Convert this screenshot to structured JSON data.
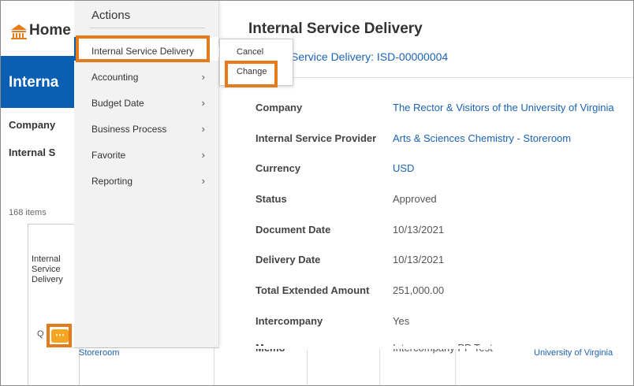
{
  "home": {
    "label": "Home"
  },
  "banner": {
    "label": "Interna"
  },
  "background": {
    "company_label": "Company",
    "isp_label": "Internal S",
    "items_count": "168 items",
    "grid_header": [
      "Internal",
      "Service",
      "Delivery"
    ],
    "search_glyph": "Q",
    "ellipsis": "⋯",
    "bottom_left": "Storeroom",
    "bottom_right": "University of Virginia"
  },
  "actions": {
    "title": "Actions",
    "items": [
      {
        "label": "Internal Service Delivery",
        "has_chevron": false
      },
      {
        "label": "Accounting",
        "has_chevron": true
      },
      {
        "label": "Budget Date",
        "has_chevron": true
      },
      {
        "label": "Business Process",
        "has_chevron": true
      },
      {
        "label": "Favorite",
        "has_chevron": true
      },
      {
        "label": "Reporting",
        "has_chevron": true
      }
    ],
    "chevron": "›"
  },
  "popup": {
    "items": [
      "Cancel",
      "Change"
    ]
  },
  "main": {
    "title": "Internal Service Delivery",
    "subtitle": "Service Delivery: ISD-00000004",
    "fields": [
      {
        "label": "Company",
        "value": "The Rector & Visitors of the University of Virginia",
        "link": true
      },
      {
        "label": "Internal Service Provider",
        "value": "Arts & Sciences Chemistry - Storeroom",
        "link": true
      },
      {
        "label": "Currency",
        "value": "USD",
        "link": true
      },
      {
        "label": "Status",
        "value": "Approved",
        "link": false
      },
      {
        "label": "Document Date",
        "value": "10/13/2021",
        "link": false
      },
      {
        "label": "Delivery Date",
        "value": "10/13/2021",
        "link": false
      },
      {
        "label": "Total Extended Amount",
        "value": "251,000.00",
        "link": false
      },
      {
        "label": "Intercompany",
        "value": "Yes",
        "link": false
      },
      {
        "label": "Memo",
        "value": "Intercompany PP Test",
        "link": false
      }
    ]
  },
  "colors": {
    "accent": "#0b5fb3",
    "highlight": "#e37a1b",
    "link": "#1a62b6"
  }
}
